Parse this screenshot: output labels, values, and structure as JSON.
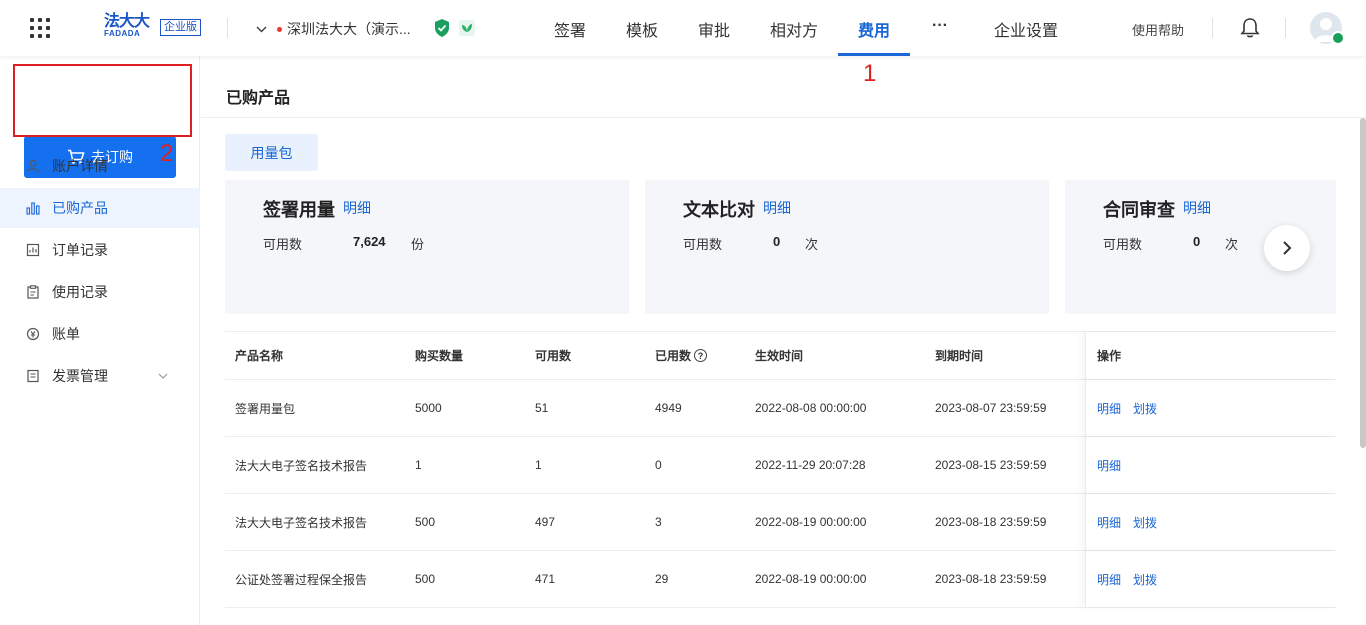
{
  "header": {
    "logo_main": "法大大",
    "logo_sub": "FADADA",
    "edition": "企业版",
    "company_name": "深圳法大大（演示...",
    "nav": [
      "签署",
      "模板",
      "审批",
      "相对方",
      "费用",
      "···",
      "企业设置"
    ],
    "active_nav": "费用",
    "help": "使用帮助"
  },
  "annotations": {
    "marker1": "1",
    "marker2": "2"
  },
  "sidebar": {
    "buy_button": "去订购",
    "items": [
      {
        "label": "账户详情",
        "icon": "user-icon"
      },
      {
        "label": "已购产品",
        "icon": "bar-chart-icon"
      },
      {
        "label": "订单记录",
        "icon": "order-icon"
      },
      {
        "label": "使用记录",
        "icon": "clipboard-icon"
      },
      {
        "label": "账单",
        "icon": "bill-icon"
      },
      {
        "label": "发票管理",
        "icon": "invoice-icon"
      }
    ],
    "active": "已购产品"
  },
  "main": {
    "title": "已购产品",
    "tab": "用量包",
    "cards": [
      {
        "title": "签署用量",
        "link": "明细",
        "label": "可用数",
        "value": "7,624",
        "unit": "份"
      },
      {
        "title": "文本比对",
        "link": "明细",
        "label": "可用数",
        "value": "0",
        "unit": "次"
      },
      {
        "title": "合同审查",
        "link": "明细",
        "label": "可用数",
        "value": "0",
        "unit": "次"
      }
    ],
    "table": {
      "headers": [
        "产品名称",
        "购买数量",
        "可用数",
        "已用数",
        "生效时间",
        "到期时间",
        "操作"
      ],
      "help_mark": "?",
      "rows": [
        {
          "name": "签署用量包",
          "bought": "5000",
          "available": "51",
          "used": "4949",
          "start": "2022-08-08 00:00:00",
          "end": "2023-08-07 23:59:59",
          "ops": [
            "明细",
            "划拨"
          ]
        },
        {
          "name": "法大大电子签名技术报告",
          "bought": "1",
          "available": "1",
          "used": "0",
          "start": "2022-11-29 20:07:28",
          "end": "2023-08-15 23:59:59",
          "ops": [
            "明细"
          ]
        },
        {
          "name": "法大大电子签名技术报告",
          "bought": "500",
          "available": "497",
          "used": "3",
          "start": "2022-08-19 00:00:00",
          "end": "2023-08-18 23:59:59",
          "ops": [
            "明细",
            "划拨"
          ]
        },
        {
          "name": "公证处签署过程保全报告",
          "bought": "500",
          "available": "471",
          "used": "29",
          "start": "2022-08-19 00:00:00",
          "end": "2023-08-18 23:59:59",
          "ops": [
            "明细",
            "划拨"
          ]
        }
      ]
    }
  },
  "colors": {
    "accent": "#1a66d6",
    "button": "#1570ef",
    "annotation": "#e02020"
  }
}
